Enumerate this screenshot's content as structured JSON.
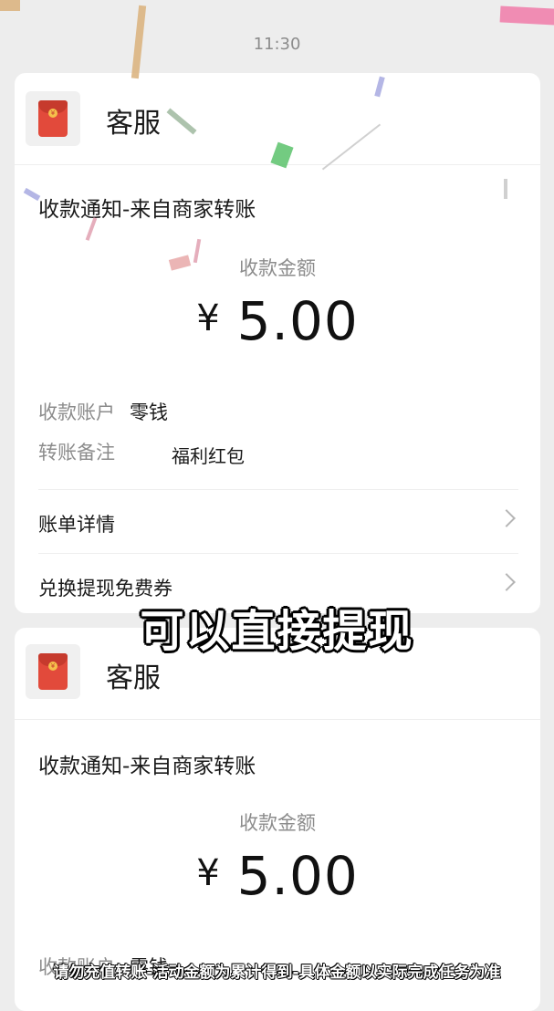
{
  "status_time": "11:30",
  "caption": "可以直接提现",
  "disclaimer": "请勿充值转账-活动金额为累计得到-具体金额以实际完成任务为准",
  "cards": [
    {
      "sender": "客服",
      "title": "收款通知-来自商家转账",
      "amount_label": "收款金额",
      "currency": "¥",
      "amount": "5.00",
      "account_key": "收款账户",
      "account_value": "零钱",
      "remark_key": "转账备注",
      "remark_value": "福利红包",
      "links": [
        "账单详情",
        "兑换提现免费券"
      ]
    },
    {
      "sender": "客服",
      "title": "收款通知-来自商家转账",
      "amount_label": "收款金额",
      "currency": "¥",
      "amount": "5.00",
      "account_key": "收款账户",
      "account_value": "零钱"
    }
  ],
  "colors": {
    "background": "#ededed",
    "card": "#ffffff",
    "envelope_red": "#e24a3b",
    "envelope_gold": "#f5c04b",
    "secondary_text": "#8c8c8c"
  },
  "icons": {
    "avatar": "red-envelope-icon",
    "chevron": "chevron-right-icon"
  }
}
